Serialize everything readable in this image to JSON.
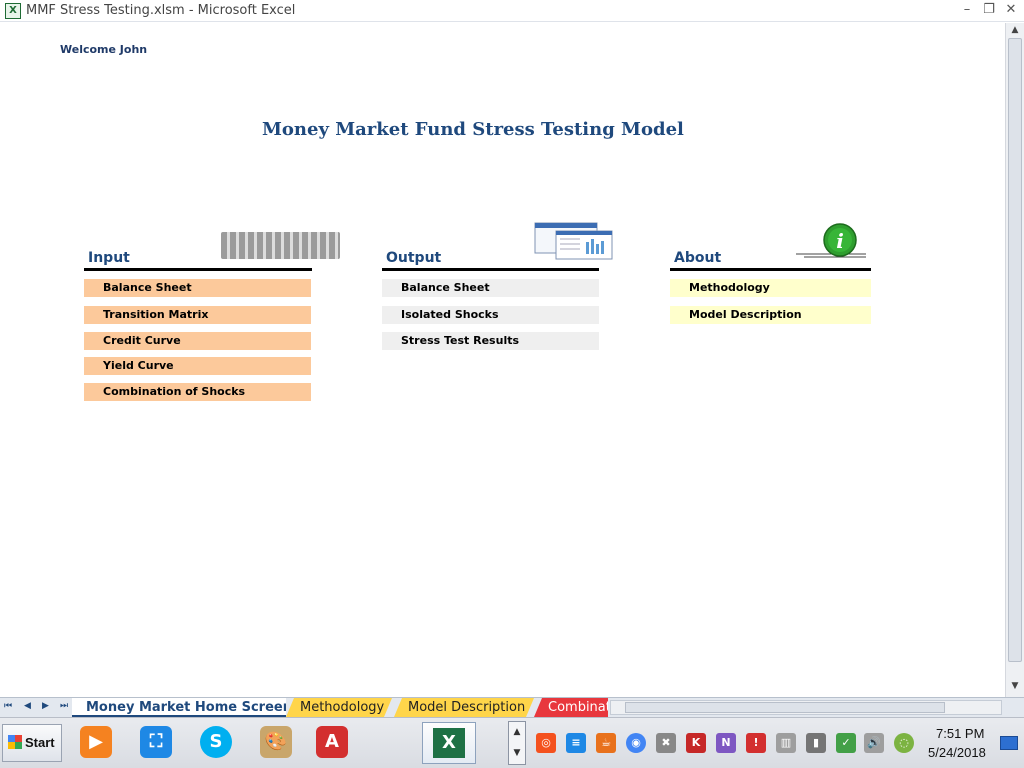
{
  "window": {
    "title": "MMF Stress Testing.xlsm - Microsoft Excel",
    "app_icon_letter": "X",
    "minimize_label": "–",
    "restore_label": "❐",
    "close_label": "✕"
  },
  "sheet": {
    "welcome": "Welcome John",
    "title": "Money Market Fund Stress Testing Model",
    "sections": {
      "input": {
        "heading": "Input",
        "items": [
          "Balance Sheet",
          "Transition Matrix",
          "Credit Curve",
          "Yield Curve",
          "Combination of Shocks"
        ]
      },
      "output": {
        "heading": "Output",
        "items": [
          "Balance Sheet",
          "Isolated Shocks",
          "Stress Test Results"
        ]
      },
      "about": {
        "heading": "About",
        "items": [
          "Methodology",
          "Model Description"
        ]
      }
    },
    "info_icon_letter": "i",
    "colors": {
      "title": "#1f497d",
      "input_button": "#fcc99b",
      "output_button": "#efefef",
      "about_button": "#ffffcc"
    }
  },
  "tabs": {
    "nav": [
      "⏮",
      "◀",
      "▶",
      "⏭"
    ],
    "items": [
      {
        "label": "Money Market Home Screen",
        "state": "active"
      },
      {
        "label": "Methodology",
        "color": "#ffd54a"
      },
      {
        "label": "Model Description",
        "color": "#ffd54a"
      },
      {
        "label": "Combinat",
        "color": "#e8373d"
      }
    ]
  },
  "taskbar": {
    "start_label": "Start",
    "apps": [
      {
        "icon": "media-player-icon",
        "glyph": "▶",
        "color": "#f58220"
      },
      {
        "icon": "screen-capture-icon",
        "glyph": "⛶",
        "color": "#1e88e5"
      },
      {
        "icon": "skype-icon",
        "glyph": "S",
        "color": "#00aff0"
      },
      {
        "icon": "paint-icon",
        "glyph": "🎨",
        "color": "#c9a66b"
      },
      {
        "icon": "acrobat-icon",
        "glyph": "A",
        "color": "#d32f2f"
      }
    ],
    "excel_glyph": "X",
    "tray_up": "▲",
    "tray_down": "▼",
    "tray_icons": [
      {
        "icon": "tray-app-orange-icon",
        "glyph": "◎",
        "color": "#f4511e"
      },
      {
        "icon": "tray-app-blue-icon",
        "glyph": "≡",
        "color": "#1e88e5"
      },
      {
        "icon": "tray-java-icon",
        "glyph": "☕",
        "color": "#e8711c"
      },
      {
        "icon": "tray-chrome-icon",
        "glyph": "◉",
        "color": "#4285f4"
      },
      {
        "icon": "tray-shield-icon",
        "glyph": "✖",
        "color": "#888888"
      },
      {
        "icon": "tray-kaspersky-icon",
        "glyph": "K",
        "color": "#c62828"
      },
      {
        "icon": "tray-onenote-icon",
        "glyph": "N",
        "color": "#7e57c2"
      },
      {
        "icon": "tray-alert-icon",
        "glyph": "!",
        "color": "#d32f2f"
      },
      {
        "icon": "tray-monitor-icon",
        "glyph": "▥",
        "color": "#9e9e9e"
      },
      {
        "icon": "tray-battery-icon",
        "glyph": "▮",
        "color": "#757575"
      },
      {
        "icon": "tray-network-icon",
        "glyph": "▁",
        "color": "#9e9e9e"
      },
      {
        "icon": "tray-wifi-icon",
        "glyph": "✓",
        "color": "#43a047"
      },
      {
        "icon": "tray-volume-icon",
        "glyph": "🔊",
        "color": "#9e9e9e"
      },
      {
        "icon": "tray-leaf-icon",
        "glyph": "◌",
        "color": "#7cb342"
      }
    ],
    "time": "7:51 PM",
    "date": "5/24/2018"
  }
}
